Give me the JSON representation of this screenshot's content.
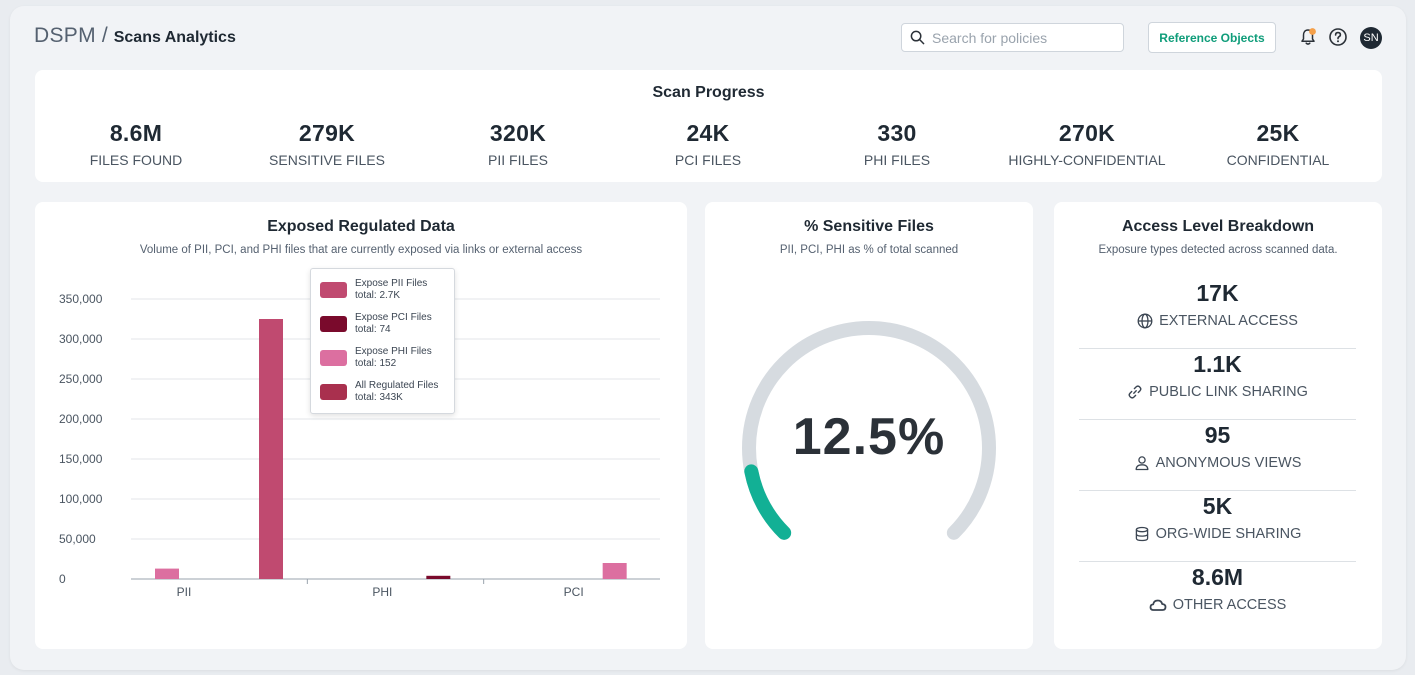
{
  "header": {
    "breadcrumb_root": "DSPM",
    "breadcrumb_sep": "/",
    "page_title": "Scans Analytics",
    "search_placeholder": "Search for policies",
    "reference_button": "Reference Objects",
    "avatar_initials": "SN",
    "icons": [
      "search-icon",
      "bell-icon",
      "help-icon"
    ],
    "accent_color": "#0f9d7a",
    "notification_dot_color": "#f5a04a"
  },
  "scan_progress": {
    "title": "Scan Progress",
    "stats": [
      {
        "value": "8.6M",
        "label": "FILES FOUND"
      },
      {
        "value": "279K",
        "label": "SENSITIVE FILES"
      },
      {
        "value": "320K",
        "label": "PII FILES"
      },
      {
        "value": "24K",
        "label": "PCI FILES"
      },
      {
        "value": "330",
        "label": "PHI FILES"
      },
      {
        "value": "270K",
        "label": "HIGHLY-CONFIDENTIAL"
      },
      {
        "value": "25K",
        "label": "CONFIDENTIAL"
      }
    ]
  },
  "exposed": {
    "title": "Exposed Regulated Data",
    "subtitle": "Volume of PII, PCI, and PHI files that are currently exposed via links or external access",
    "tooltip": [
      {
        "name": "Expose PII Files",
        "total": "total: 2.7K",
        "color": "#c04a70"
      },
      {
        "name": "Expose PCI Files",
        "total": "total: 74",
        "color": "#7a0a2c"
      },
      {
        "name": "Expose PHI Files",
        "total": "total: 152",
        "color": "#dc6fa0"
      },
      {
        "name": "All Regulated Files",
        "total": "total: 343K",
        "color": "#a9304e"
      }
    ]
  },
  "chart_data": {
    "type": "bar",
    "categories": [
      "PII",
      "PHI",
      "PCI"
    ],
    "yticks": [
      "350,000",
      "300,000",
      "250,000",
      "200,000",
      "150,000",
      "100,000",
      "50,000",
      "0"
    ],
    "ylim": [
      0,
      350000
    ],
    "grid": true,
    "bars": [
      {
        "category": "PII",
        "slot": 0,
        "value": 13000,
        "color": "#dc6fa0"
      },
      {
        "category": "PII",
        "slot": 1,
        "value": 325000,
        "color": "#c04a70"
      },
      {
        "category": "PHI",
        "slot": 1,
        "value": 4000,
        "color": "#7a0a2c"
      },
      {
        "category": "PCI",
        "slot": 1,
        "value": 20000,
        "color": "#dc6fa0"
      }
    ]
  },
  "sensitive": {
    "title": "% Sensitive Files",
    "subtitle": "PII, PCI, PHI as % of total scanned",
    "value_text": "12.5%",
    "percent": 12.5,
    "track_color": "#d6dbe0",
    "fill_color": "#12b095"
  },
  "access": {
    "title": "Access Level Breakdown",
    "subtitle": "Exposure types detected across scanned data.",
    "items": [
      {
        "value": "17K",
        "label": "EXTERNAL ACCESS",
        "icon": "globe-icon"
      },
      {
        "value": "1.1K",
        "label": "PUBLIC LINK SHARING",
        "icon": "link-icon"
      },
      {
        "value": "95",
        "label": "ANONYMOUS VIEWS",
        "icon": "user-icon"
      },
      {
        "value": "5K",
        "label": "ORG-WIDE SHARING",
        "icon": "database-icon"
      },
      {
        "value": "8.6M",
        "label": "OTHER ACCESS",
        "icon": "cloud-icon"
      }
    ]
  }
}
